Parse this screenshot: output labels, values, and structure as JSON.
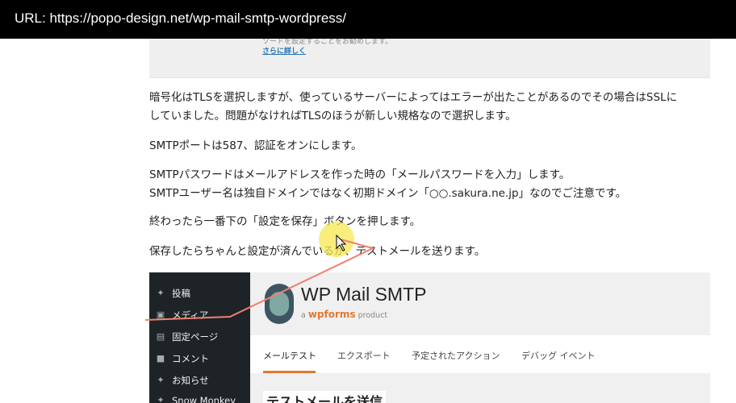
{
  "url_bar": {
    "text": "URL: https://popo-design.net/wp-mail-smtp-wordpress/"
  },
  "top_screenshot": {
    "faded_text": "ソードを設定することをお勧めします。",
    "link": "さらに詳しく"
  },
  "paragraphs": [
    [
      "暗号化はTLSを選択しますが、使っているサーバーによってはエラーが出たことがあるのでその場合はSSLに",
      "していました。問題がなければTLSのほうが新しい規格なので選択します。"
    ],
    [
      "SMTPポートは587、認証をオンにします。"
    ],
    [
      "SMTPパスワードはメールアドレスを作った時の「メールパスワードを入力」します。",
      "SMTPユーザー名は独自ドメインではなく初期ドメイン「○○.sakura.ne.jp」なのでご注意です。"
    ],
    [
      "終わったら一番下の「設定を保存」ボタンを押します。"
    ],
    [
      "保存したらちゃんと設定が済んでいるか、テストメールを送ります。"
    ]
  ],
  "wp_screenshot": {
    "sidebar": [
      {
        "label": "投稿",
        "icon": "pin-icon"
      },
      {
        "label": "メディア",
        "icon": "media-icon"
      },
      {
        "label": "固定ページ",
        "icon": "page-icon"
      },
      {
        "label": "コメント",
        "icon": "comment-icon"
      },
      {
        "label": "お知らせ",
        "icon": "pin-icon"
      },
      {
        "label": "Snow Monkey",
        "icon": "pin-icon"
      }
    ],
    "plugin_title": "WP Mail SMTP",
    "plugin_sub_a": "a",
    "plugin_sub_brand": "wpforms",
    "plugin_sub_product": "product",
    "tabs": [
      "メールテスト",
      "エクスポート",
      "予定されたアクション",
      "デバッグ イベント"
    ],
    "section_heading": "テストメールを送信"
  },
  "colors": {
    "accent": "#e27730",
    "annotation": "#f08070",
    "highlight": "#f5e850"
  }
}
